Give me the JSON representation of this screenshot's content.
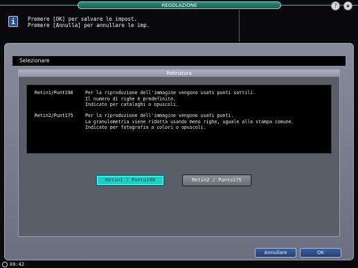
{
  "header": {
    "title": "REGOLAZIONE",
    "help_icon": "help-icon",
    "settings_icon": "gear-icon",
    "help_glyph": "?",
    "settings_glyph": "✱"
  },
  "message": {
    "icon_glyph": "i",
    "line1": "Premere [OK] per salvare le impost.",
    "line2": "Premere [Annulla] per annullare le imp."
  },
  "panel": {
    "label": "Selezionare",
    "section_title": "Retinatura"
  },
  "descriptions": [
    {
      "name": "Retin1/Punt190",
      "lines": [
        "Per la riproduzione dell'immagine vengono usati punti sottili.",
        "Il numero di righe è predefinito.",
        "Indicato per cataloghi o opuscoli."
      ]
    },
    {
      "name": "Retin2/Punt175",
      "lines": [
        "Per la riproduzione dell'immagine vengono usati punti.",
        "La granulometria viene ridotta usando meno righe, uguale alla stampa comune.",
        "Indicato per fotografia a colori o opuscoli."
      ]
    }
  ],
  "options": [
    {
      "label": "Retin1 / Punto190",
      "selected": true
    },
    {
      "label": "Retin2 / Punto175",
      "selected": false
    }
  ],
  "buttons": {
    "cancel": "Annullare",
    "ok": "OK"
  },
  "status": {
    "time": "09:42"
  },
  "colors": {
    "selected_option": "#17d3c5",
    "title_bar": "#2f8a7c",
    "action_button": "#3e5f9c"
  }
}
